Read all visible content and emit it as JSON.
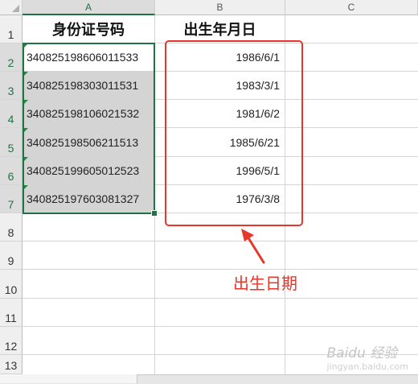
{
  "columns": [
    "A",
    "B",
    "C"
  ],
  "rows": [
    "1",
    "2",
    "3",
    "4",
    "5",
    "6",
    "7",
    "8",
    "9",
    "10",
    "11",
    "12",
    "13"
  ],
  "headers": {
    "id_header": "身份证号码",
    "date_header": "出生年月日"
  },
  "data_rows": [
    {
      "id": "340825198606011533",
      "date": "1986/6/1"
    },
    {
      "id": "340825198303011531",
      "date": "1983/3/1"
    },
    {
      "id": "340825198106021532",
      "date": "1981/6/2"
    },
    {
      "id": "340825198506211513",
      "date": "1985/6/21"
    },
    {
      "id": "340825199605012523",
      "date": "1996/5/1"
    },
    {
      "id": "340825197603081327",
      "date": "1976/3/8"
    }
  ],
  "annotation": "出生日期",
  "watermark": {
    "brand": "Baidu 经验",
    "url": "jingyan.baidu.com"
  },
  "colors": {
    "accent": "#217346",
    "annotation": "#e8362b",
    "selection_fill": "#d4d4d4"
  }
}
